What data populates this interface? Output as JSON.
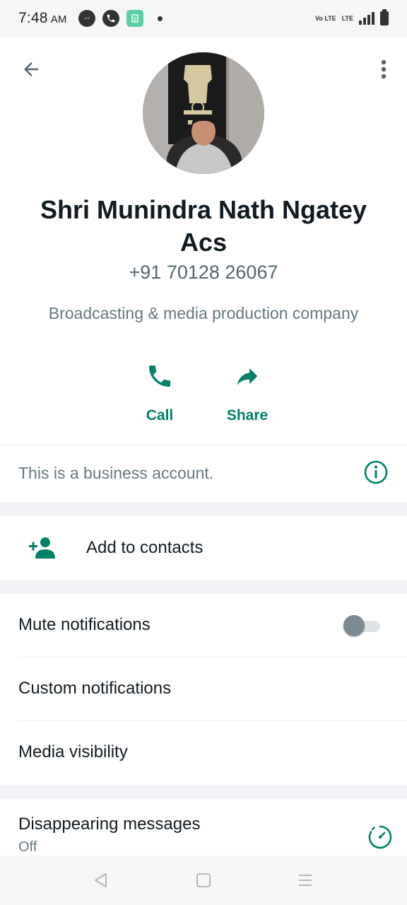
{
  "status_bar": {
    "time": "7:48",
    "ampm": "AM",
    "network": "Vo LTE",
    "network_sub": "LTE"
  },
  "icons": {
    "back": "arrow-left-icon",
    "menu": "more-vertical-icon",
    "call": "phone-icon",
    "share": "share-arrow-icon",
    "info": "info-icon",
    "add_contact": "person-add-icon",
    "timer": "timer-icon"
  },
  "colors": {
    "accent": "#008069",
    "muted": "#667781",
    "toggle_off": "#7c8a93"
  },
  "contact": {
    "name": "Shri Munindra Nath Ngatey Acs",
    "phone": "+91 70128 26067",
    "category": "Broadcasting & media production company"
  },
  "actions": {
    "call_label": "Call",
    "share_label": "Share"
  },
  "business_notice": "This is a business account.",
  "add_contacts_label": "Add to contacts",
  "settings": {
    "mute_label": "Mute notifications",
    "mute_enabled": false,
    "custom_label": "Custom notifications",
    "media_label": "Media visibility"
  },
  "disappearing": {
    "label": "Disappearing messages",
    "value": "Off"
  }
}
